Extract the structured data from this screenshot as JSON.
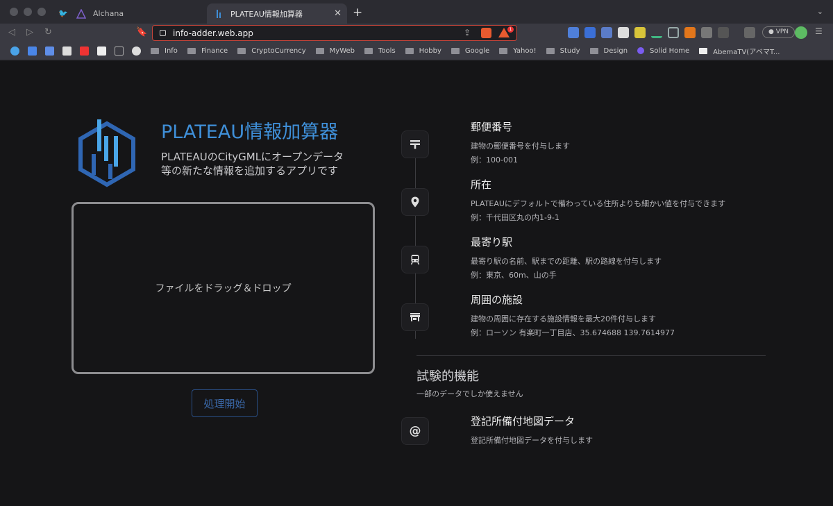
{
  "browser": {
    "tabs": [
      {
        "label": "Alchana"
      },
      {
        "label": "PLATEAU情報加算器"
      }
    ],
    "url": "info-adder.web.app",
    "vpn_label": "VPN",
    "bookmarks": [
      {
        "label": "Info"
      },
      {
        "label": "Finance"
      },
      {
        "label": "CryptoCurrency"
      },
      {
        "label": "MyWeb"
      },
      {
        "label": "Tools"
      },
      {
        "label": "Hobby"
      },
      {
        "label": "Google"
      },
      {
        "label": "Yahoo!"
      },
      {
        "label": "Study"
      },
      {
        "label": "Design"
      },
      {
        "label": "Solid Home"
      },
      {
        "label": "AbemaTV(アベマT..."
      }
    ]
  },
  "app": {
    "title": "PLATEAU情報加算器",
    "subtitle_line1": "PLATEAUのCityGMLにオープンデータ",
    "subtitle_line2": "等の新たな情報を追加するアプリです",
    "dropzone_label": "ファイルをドラッグ＆ドロップ",
    "start_button": "処理開始",
    "accent_color": "#3f8fd8"
  },
  "features": [
    {
      "title": "郵便番号",
      "desc": "建物の郵便番号を付与します",
      "example": "例：100-001",
      "icon": "postal-mark-icon"
    },
    {
      "title": "所在",
      "desc": "PLATEAUにデフォルトで備わっている住所よりも細かい値を付与できます",
      "example": "例：千代田区丸の内1-9-1",
      "icon": "location-pin-icon"
    },
    {
      "title": "最寄り駅",
      "desc": "最寄り駅の名前、駅までの距離、駅の路線を付与します",
      "example": "例：東京、60m、山の手",
      "icon": "train-icon"
    },
    {
      "title": "周囲の施設",
      "desc": "建物の周囲に存在する施設情報を最大20件付与します",
      "example": "例：ローソン 有楽町一丁目店、35.674688 139.7614977",
      "icon": "store-icon"
    }
  ],
  "experimental": {
    "title": "試験的機能",
    "subtitle": "一部のデータでしか使えません",
    "items": [
      {
        "title": "登記所備付地図データ",
        "desc": "登記所備付地図データを付与します",
        "icon": "at-sign-icon"
      }
    ]
  }
}
